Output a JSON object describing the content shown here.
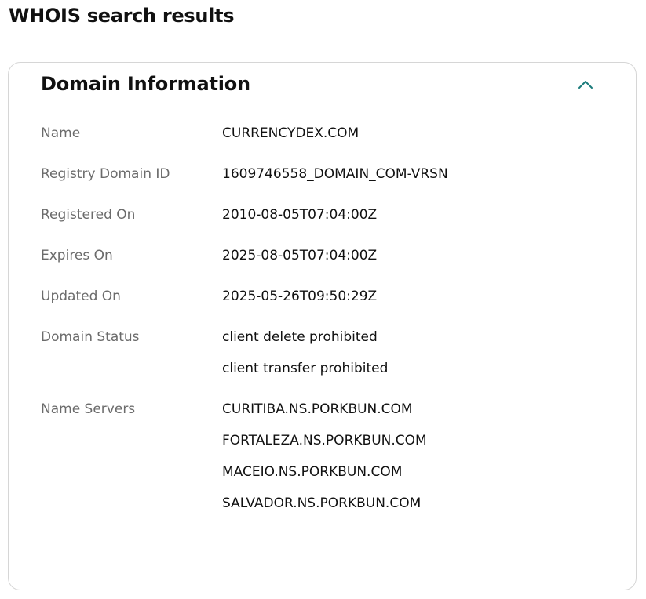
{
  "page": {
    "title": "WHOIS search results"
  },
  "domain_info": {
    "title": "Domain Information",
    "collapse_icon": "chevron-up-icon",
    "accent_color": "#1a7b7b",
    "rows": [
      {
        "label": "Name",
        "values": [
          "CURRENCYDEX.COM"
        ]
      },
      {
        "label": "Registry Domain ID",
        "values": [
          "1609746558_DOMAIN_COM-VRSN"
        ]
      },
      {
        "label": "Registered On",
        "values": [
          "2010-08-05T07:04:00Z"
        ]
      },
      {
        "label": "Expires On",
        "values": [
          "2025-08-05T07:04:00Z"
        ]
      },
      {
        "label": "Updated On",
        "values": [
          "2025-05-26T09:50:29Z"
        ]
      },
      {
        "label": "Domain Status",
        "values": [
          "client delete prohibited",
          "client transfer prohibited"
        ]
      },
      {
        "label": "Name Servers",
        "values": [
          "CURITIBA.NS.PORKBUN.COM",
          "FORTALEZA.NS.PORKBUN.COM",
          "MACEIO.NS.PORKBUN.COM",
          "SALVADOR.NS.PORKBUN.COM"
        ]
      }
    ]
  }
}
